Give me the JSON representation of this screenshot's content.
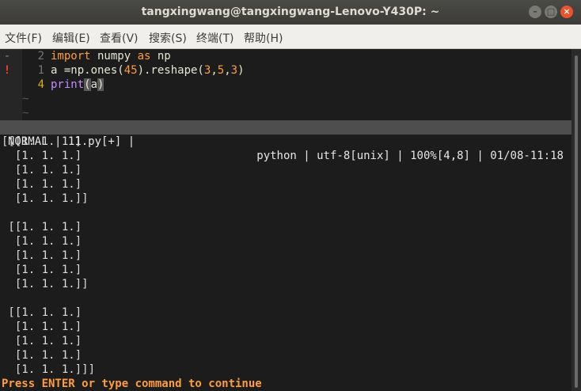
{
  "window": {
    "title": "tangxingwang@tangxingwang-Lenovo-Y430P: ~",
    "buttons": [
      "–",
      "□",
      "×"
    ]
  },
  "menu": [
    "文件(F)",
    "编辑(E)",
    "查看(V)",
    "搜索(S)",
    "终端(T)",
    "帮助(H)"
  ],
  "editor": {
    "lines": [
      {
        "sign": "-",
        "num": "2",
        "tokens": [
          {
            "t": "import",
            "c": "kw"
          },
          {
            "t": " numpy ",
            "c": ""
          },
          {
            "t": "as",
            "c": "kw"
          },
          {
            "t": " np",
            "c": ""
          }
        ]
      },
      {
        "sign": "!",
        "num": "1",
        "tokens": [
          {
            "t": "a =np.ones(",
            "c": ""
          },
          {
            "t": "45",
            "c": "num"
          },
          {
            "t": ").reshape(",
            "c": ""
          },
          {
            "t": "3",
            "c": "num"
          },
          {
            "t": ",",
            "c": ""
          },
          {
            "t": "5",
            "c": "num"
          },
          {
            "t": ",",
            "c": ""
          },
          {
            "t": "3",
            "c": "num"
          },
          {
            "t": ")",
            "c": ""
          }
        ]
      },
      {
        "sign": "",
        "num": "4",
        "tokens": [
          {
            "t": "print",
            "c": "fn"
          },
          {
            "t": "(",
            "c": "paren"
          },
          {
            "t": "a",
            "c": ""
          },
          {
            "t": ")",
            "c": "paren"
          }
        ]
      }
    ],
    "tildes": [
      "~",
      "~"
    ],
    "statusline": {
      "left": "NORMAL | 11.py[+] |",
      "right": "python | utf-8[unix] | 100%[4,8] | 01/08-11:18"
    }
  },
  "output": [
    "[[[1. 1. 1.]",
    "  [1. 1. 1.]",
    "  [1. 1. 1.]",
    "  [1. 1. 1.]",
    "  [1. 1. 1.]]",
    "",
    " [[1. 1. 1.]",
    "  [1. 1. 1.]",
    "  [1. 1. 1.]",
    "  [1. 1. 1.]",
    "  [1. 1. 1.]]",
    "",
    " [[1. 1. 1.]",
    "  [1. 1. 1.]",
    "  [1. 1. 1.]",
    "  [1. 1. 1.]",
    "  [1. 1. 1.]]]"
  ],
  "prompt": "Press ENTER or type command to continue"
}
